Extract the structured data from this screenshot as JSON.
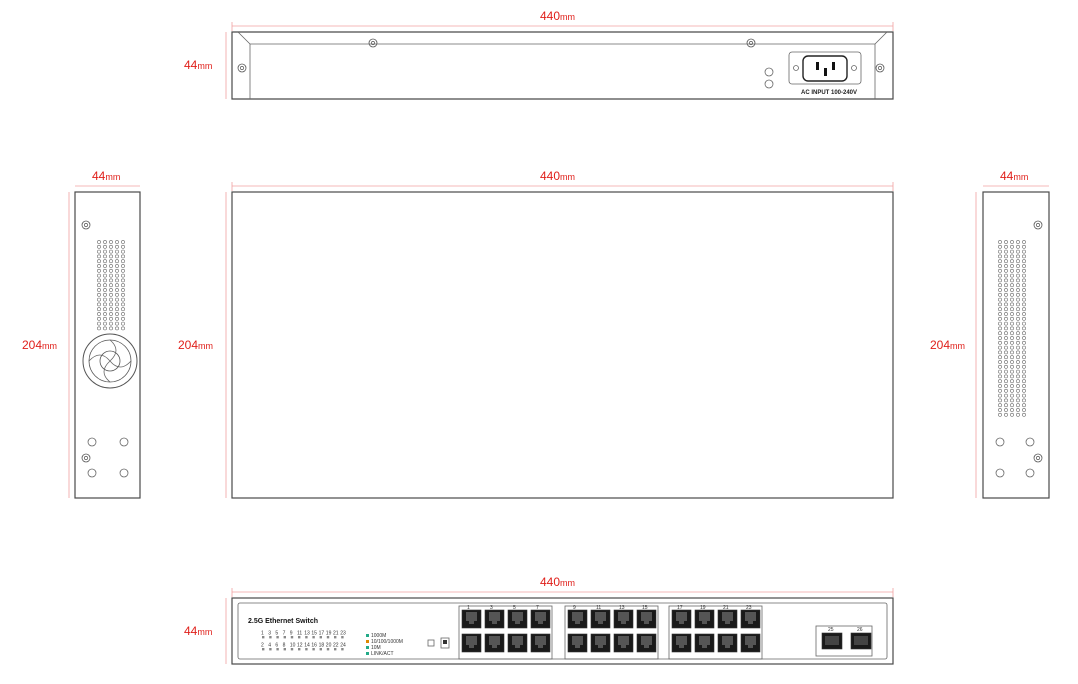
{
  "rear_view": {
    "width_label": "440",
    "height_label": "44",
    "power_label": "AC INPUT 100-240V"
  },
  "left_side_view": {
    "depth_label": "44",
    "height_label": "204"
  },
  "top_view": {
    "width_label": "440",
    "depth_label": "204"
  },
  "right_side_view": {
    "depth_label": "44",
    "height_label": "204"
  },
  "front_view": {
    "width_label": "440",
    "height_label": "44",
    "product_name": "2.5G Ethernet Switch",
    "unit": "mm",
    "led_legend": [
      "1000M",
      "10/100/1000M",
      "10M",
      "LINK/ACT"
    ],
    "port_numbers": [
      "1",
      "2",
      "3",
      "4",
      "5",
      "6",
      "7",
      "8",
      "9",
      "10",
      "11",
      "12",
      "13",
      "14",
      "15",
      "16",
      "17",
      "18",
      "19",
      "20",
      "21",
      "22",
      "23",
      "24"
    ],
    "sfp_labels": [
      "25",
      "26"
    ]
  },
  "colors": {
    "dimension": "#e0201b",
    "outline": "#4a4a4a"
  }
}
